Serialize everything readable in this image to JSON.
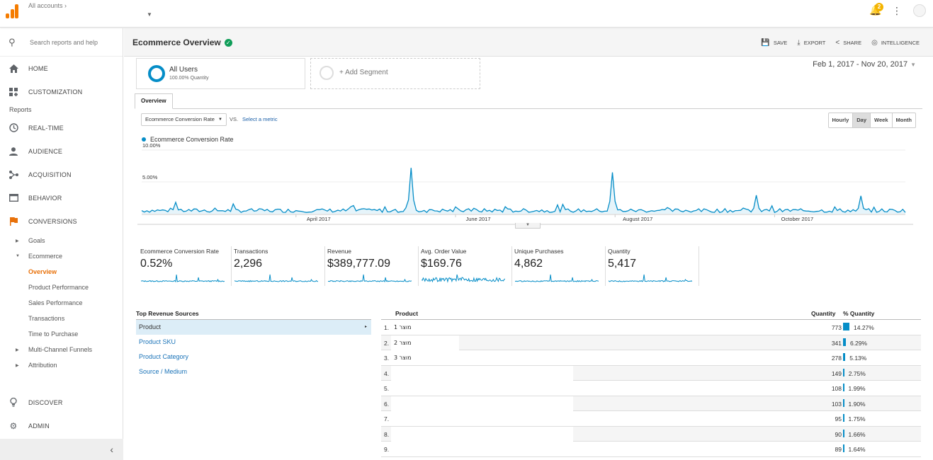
{
  "topbar": {
    "account_label": "All accounts",
    "account_chevron": "›",
    "notification_count": "2",
    "notification_icon": "bell-icon",
    "more_icon": "more-vert-icon"
  },
  "sidebar": {
    "search_placeholder": "Search reports and help",
    "home": "HOME",
    "customization": "CUSTOMIZATION",
    "reports_section": "Reports",
    "realtime": "REAL-TIME",
    "audience": "AUDIENCE",
    "acquisition": "ACQUISITION",
    "behavior": "BEHAVIOR",
    "conversions": "CONVERSIONS",
    "goals": "Goals",
    "ecommerce": "Ecommerce",
    "overview": "Overview",
    "product_performance": "Product Performance",
    "sales_performance": "Sales Performance",
    "transactions": "Transactions",
    "time_to_purchase": "Time to Purchase",
    "multi_channel": "Multi-Channel Funnels",
    "attribution": "Attribution",
    "discover": "DISCOVER",
    "admin": "ADMIN",
    "collapse": "‹"
  },
  "header": {
    "title": "Ecommerce Overview",
    "save": "SAVE",
    "export": "EXPORT",
    "share": "SHARE",
    "intelligence": "INTELLIGENCE"
  },
  "segment": {
    "name": "All Users",
    "sub": "100.00% Quantity",
    "add": "+ Add Segment"
  },
  "date_range": "Feb 1, 2017 - Nov 20, 2017",
  "tabs": {
    "overview": "Overview"
  },
  "controls": {
    "metric": "Ecommerce Conversion Rate",
    "vs": "VS.",
    "select_metric": "Select a metric",
    "hourly": "Hourly",
    "day": "Day",
    "week": "Week",
    "month": "Month"
  },
  "chart_data": {
    "type": "line",
    "series": [
      {
        "name": "Ecommerce Conversion Rate",
        "color": "#058dc7"
      }
    ],
    "y_ticks": [
      "10.00%",
      "5.00%"
    ],
    "ylim": [
      0,
      10
    ],
    "x_ticks": [
      "April 2017",
      "June 2017",
      "August 2017",
      "October 2017"
    ],
    "x_range": [
      "2017-02-01",
      "2017-11-20"
    ],
    "peaks": [
      {
        "date": "2017-02-14",
        "value": 1.8
      },
      {
        "date": "2017-05-15",
        "value": 7.2
      },
      {
        "date": "2017-07-31",
        "value": 6.5
      },
      {
        "date": "2017-09-24",
        "value": 2.9
      },
      {
        "date": "2017-11-03",
        "value": 2.8
      }
    ],
    "baseline": 0.5
  },
  "scorecards": [
    {
      "label": "Ecommerce Conversion Rate",
      "value": "0.52%"
    },
    {
      "label": "Transactions",
      "value": "2,296"
    },
    {
      "label": "Revenue",
      "value": "$389,777.09"
    },
    {
      "label": "Avg. Order Value",
      "value": "$169.76"
    },
    {
      "label": "Unique Purchases",
      "value": "4,862"
    },
    {
      "label": "Quantity",
      "value": "5,417"
    }
  ],
  "top_revenue": {
    "title": "Top Revenue Sources",
    "items": [
      "Product",
      "Product SKU",
      "Product Category",
      "Source / Medium"
    ],
    "selected_arrow": "▸"
  },
  "product_table": {
    "headers": {
      "product": "Product",
      "quantity": "Quantity",
      "pct": "% Quantity"
    },
    "rows": [
      {
        "idx": "1.",
        "name": "מוצר 1",
        "qty": "773",
        "pct": "14.27%",
        "share": 14.27
      },
      {
        "idx": "2.",
        "name": "מוצר 2",
        "qty": "341",
        "pct": "6.29%",
        "share": 6.29
      },
      {
        "idx": "3.",
        "name": "מוצר 3",
        "qty": "278",
        "pct": "5.13%",
        "share": 5.13
      },
      {
        "idx": "4.",
        "name": "",
        "qty": "149",
        "pct": "2.75%",
        "share": 2.75
      },
      {
        "idx": "5.",
        "name": "",
        "qty": "108",
        "pct": "1.99%",
        "share": 1.99
      },
      {
        "idx": "6.",
        "name": "",
        "qty": "103",
        "pct": "1.90%",
        "share": 1.9
      },
      {
        "idx": "7.",
        "name": "",
        "qty": "95",
        "pct": "1.75%",
        "share": 1.75
      },
      {
        "idx": "8.",
        "name": "",
        "qty": "90",
        "pct": "1.66%",
        "share": 1.66
      },
      {
        "idx": "9.",
        "name": "",
        "qty": "89",
        "pct": "1.64%",
        "share": 1.64
      }
    ]
  }
}
